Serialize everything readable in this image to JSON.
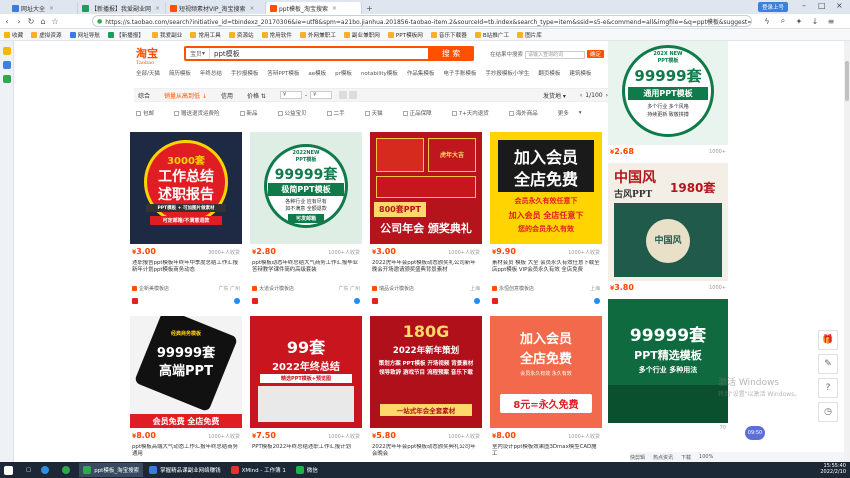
{
  "browser": {
    "tabs": [
      {
        "label": "网址大全",
        "active": false
      },
      {
        "label": "【新播报】我爱副业网",
        "active": false
      },
      {
        "label": "短视频素材VIP_淘宝搜索",
        "active": false
      },
      {
        "label": "ppt模板_淘宝搜索",
        "active": true
      }
    ],
    "url": "https://s.taobao.com/search?initiative_id=tbindexz_20170306&ie=utf8&spm=a21bo.jianhua.201856-taobao-item.2&sourceId=tb.index&search_type=item&ssid=s5-e&commend=all&imgfile=&q=ppt模板&suggest=history_2&_input_charset=utf-8&wq=&suggest_query=&source=suggest",
    "sign_in": "登录上号",
    "bookmarks": [
      "收藏",
      "虚拟资源",
      "网址导航",
      "【新播报】",
      "我爱副业",
      "常用工具",
      "资源站",
      "常用软件",
      "外网兼职工",
      "副业兼职网",
      "PPT模板网",
      "音乐下载器",
      "B站推广工",
      "图片库"
    ]
  },
  "header": {
    "logo": "淘宝",
    "logo_sub": "Taobao",
    "search_category": "宝贝",
    "search_query": "ppt模板",
    "search_button": "搜 索",
    "sub_search_label": "在结果中搜索",
    "sub_search_placeholder": "请输入查询的词",
    "sub_search_button": "确定"
  },
  "categories": [
    "全部/天猫",
    "简历模板",
    "年终总结",
    "手抄报模板",
    "答辩PPT模板",
    "ae模板",
    "pr模板",
    "notability模板",
    "作品集模板",
    "电子手账模板",
    "手抄报模板小学生",
    "翻页模板",
    "建筑模板"
  ],
  "filters": {
    "items": [
      "综合",
      "销量从高到低",
      "信用",
      "价格",
      "¥",
      "-",
      "¥"
    ],
    "ship": "发货地",
    "page": "1/100"
  },
  "options": [
    "包邮",
    "赠送退货运费险",
    "新品",
    "公益宝贝",
    "二手",
    "天猫",
    "正品保障",
    "7+天内退货",
    "海外商品",
    "更多"
  ],
  "products": [
    {
      "price": "3.00",
      "sold": "3000+人收货",
      "title": "述职报告ppt模板年终年中季度总结工作汇报新年计划ppt模板商务动态",
      "shop": "企新美模板店",
      "loc": "广东 广州"
    },
    {
      "price": "2.80",
      "sold": "1000+人收货",
      "title": "ppt模板动态年终总结大气商务工作汇报毕业答辩教学课件简约高级套装",
      "shop": "大道设计模板店",
      "loc": "广东 广州"
    },
    {
      "price": "3.00",
      "sold": "1000+人收货",
      "title": "2022虎年年会ppt模板动态颁奖礼公司新年晚会开场邀请颁奖盛典背景素材",
      "shop": "瑞品设计模板店",
      "loc": "上海"
    },
    {
      "price": "9.90",
      "sold": "1000+人收货",
      "title": "素材会员 模板 大全 会员永久有效任意下载全店ppt模板 VIP会员永久有效 全店免费",
      "shop": "永恒创意模板店",
      "loc": "上海"
    },
    {
      "price": "8.00",
      "sold": "1000+人收货",
      "title": "ppt模板高端大气动态工作汇报年终总结商务通用",
      "shop": "",
      "loc": ""
    },
    {
      "price": "7.50",
      "sold": "1000+人收货",
      "title": "PPT模板2022年终总结述职工作汇报计划",
      "shop": "",
      "loc": ""
    },
    {
      "price": "5.80",
      "sold": "1000+人收货",
      "title": "2022虎年年会ppt模板动态颁奖典礼公司年会晚会",
      "shop": "",
      "loc": ""
    },
    {
      "price": "8.00",
      "sold": "1000+人收货",
      "title": "室内设计ppt模板效果图3Dmax模型CAD施工",
      "shop": "",
      "loc": ""
    }
  ],
  "side": [
    {
      "price": "2.68",
      "sold": "1000+"
    },
    {
      "price": "3.80",
      "sold": "1000+"
    },
    {
      "price": "",
      "sold": "70"
    }
  ],
  "posters": {
    "p1_top": "3000套",
    "p1_main1": "工作总结",
    "p1_main2": "述职报告",
    "p1_sub": "PPT模板 + 可加图片做素材",
    "p1_bottom": "可定邮箱/不满意退款",
    "p2_top1": "2022NEW",
    "p2_top2": "PPT模板",
    "p2_num": "99999套",
    "p2_main": "极简PPT模板",
    "p2_sub1": "各种行业 应有尽有",
    "p2_sub2": "如不满意 全额退款",
    "p2_tag": "可发邮箱",
    "p3_hdr": "虎年大吉",
    "p3_badge": "800套PPT",
    "p3_main": "公司年会 颁奖典礼",
    "p4_main1": "加入会员",
    "p4_main2": "全店免费",
    "p4_sub": "会员永久有效任意下",
    "p4_sub2": "加入会员 全店任意下",
    "p4_sub3": "您的会员永久有效",
    "p5_hdr": "经典商务模板",
    "p5_num": "99999套",
    "p5_main": "高端PPT",
    "p5_foot": "会员免费 全店免费",
    "p6_num": "99套",
    "p6_main": "2022年终总结",
    "p6_sub": "精选PPT模板+预览图",
    "p7_num": "180G",
    "p7_main": "2022年新年策划",
    "p7_lines": "策划方案 PPT模板 开场视频 背景素材 领导致辞 游戏节目 流程预案 音乐下载",
    "p7_foot": "一站式年会全套素材",
    "p8_main1": "加入会员",
    "p8_main2": "全店免费",
    "p8_sub": "会员永久有效 永久有效",
    "p8_foot": "8元=永久免费",
    "s1_top": "202X NEW",
    "s1_top2": "PPT模板",
    "s1_num": "99999套",
    "s1_main": "通用PPT模板",
    "s1_sub": "多个行业 多个风格",
    "s1_sub2": "持续更新 致敬拼搏",
    "s2_main": "中国风",
    "s2_sub": "古风PPT",
    "s2_num": "1980套",
    "s2_sub2": "中国风",
    "s3_num": "99999套",
    "s3_main": "PPT精选模板",
    "s3_sub": "多个行业 多种用法"
  },
  "watermark": {
    "line1": "激活 Windows",
    "line2": "转到\"设置\"以激活 Windows。"
  },
  "badge": "09:50",
  "statusbar": [
    "快剪辑",
    "热点资讯",
    "下载",
    "100%"
  ],
  "taskbar": {
    "items": [
      "ppt模板_淘宝搜索",
      "掌握精品课副业网络赚钱",
      "XMind - 工作簿 1",
      "微信"
    ],
    "time": "15:55:40",
    "date": "2022/2/10"
  },
  "colors": {
    "brand": "#ff5000",
    "price": "#ff4400"
  }
}
